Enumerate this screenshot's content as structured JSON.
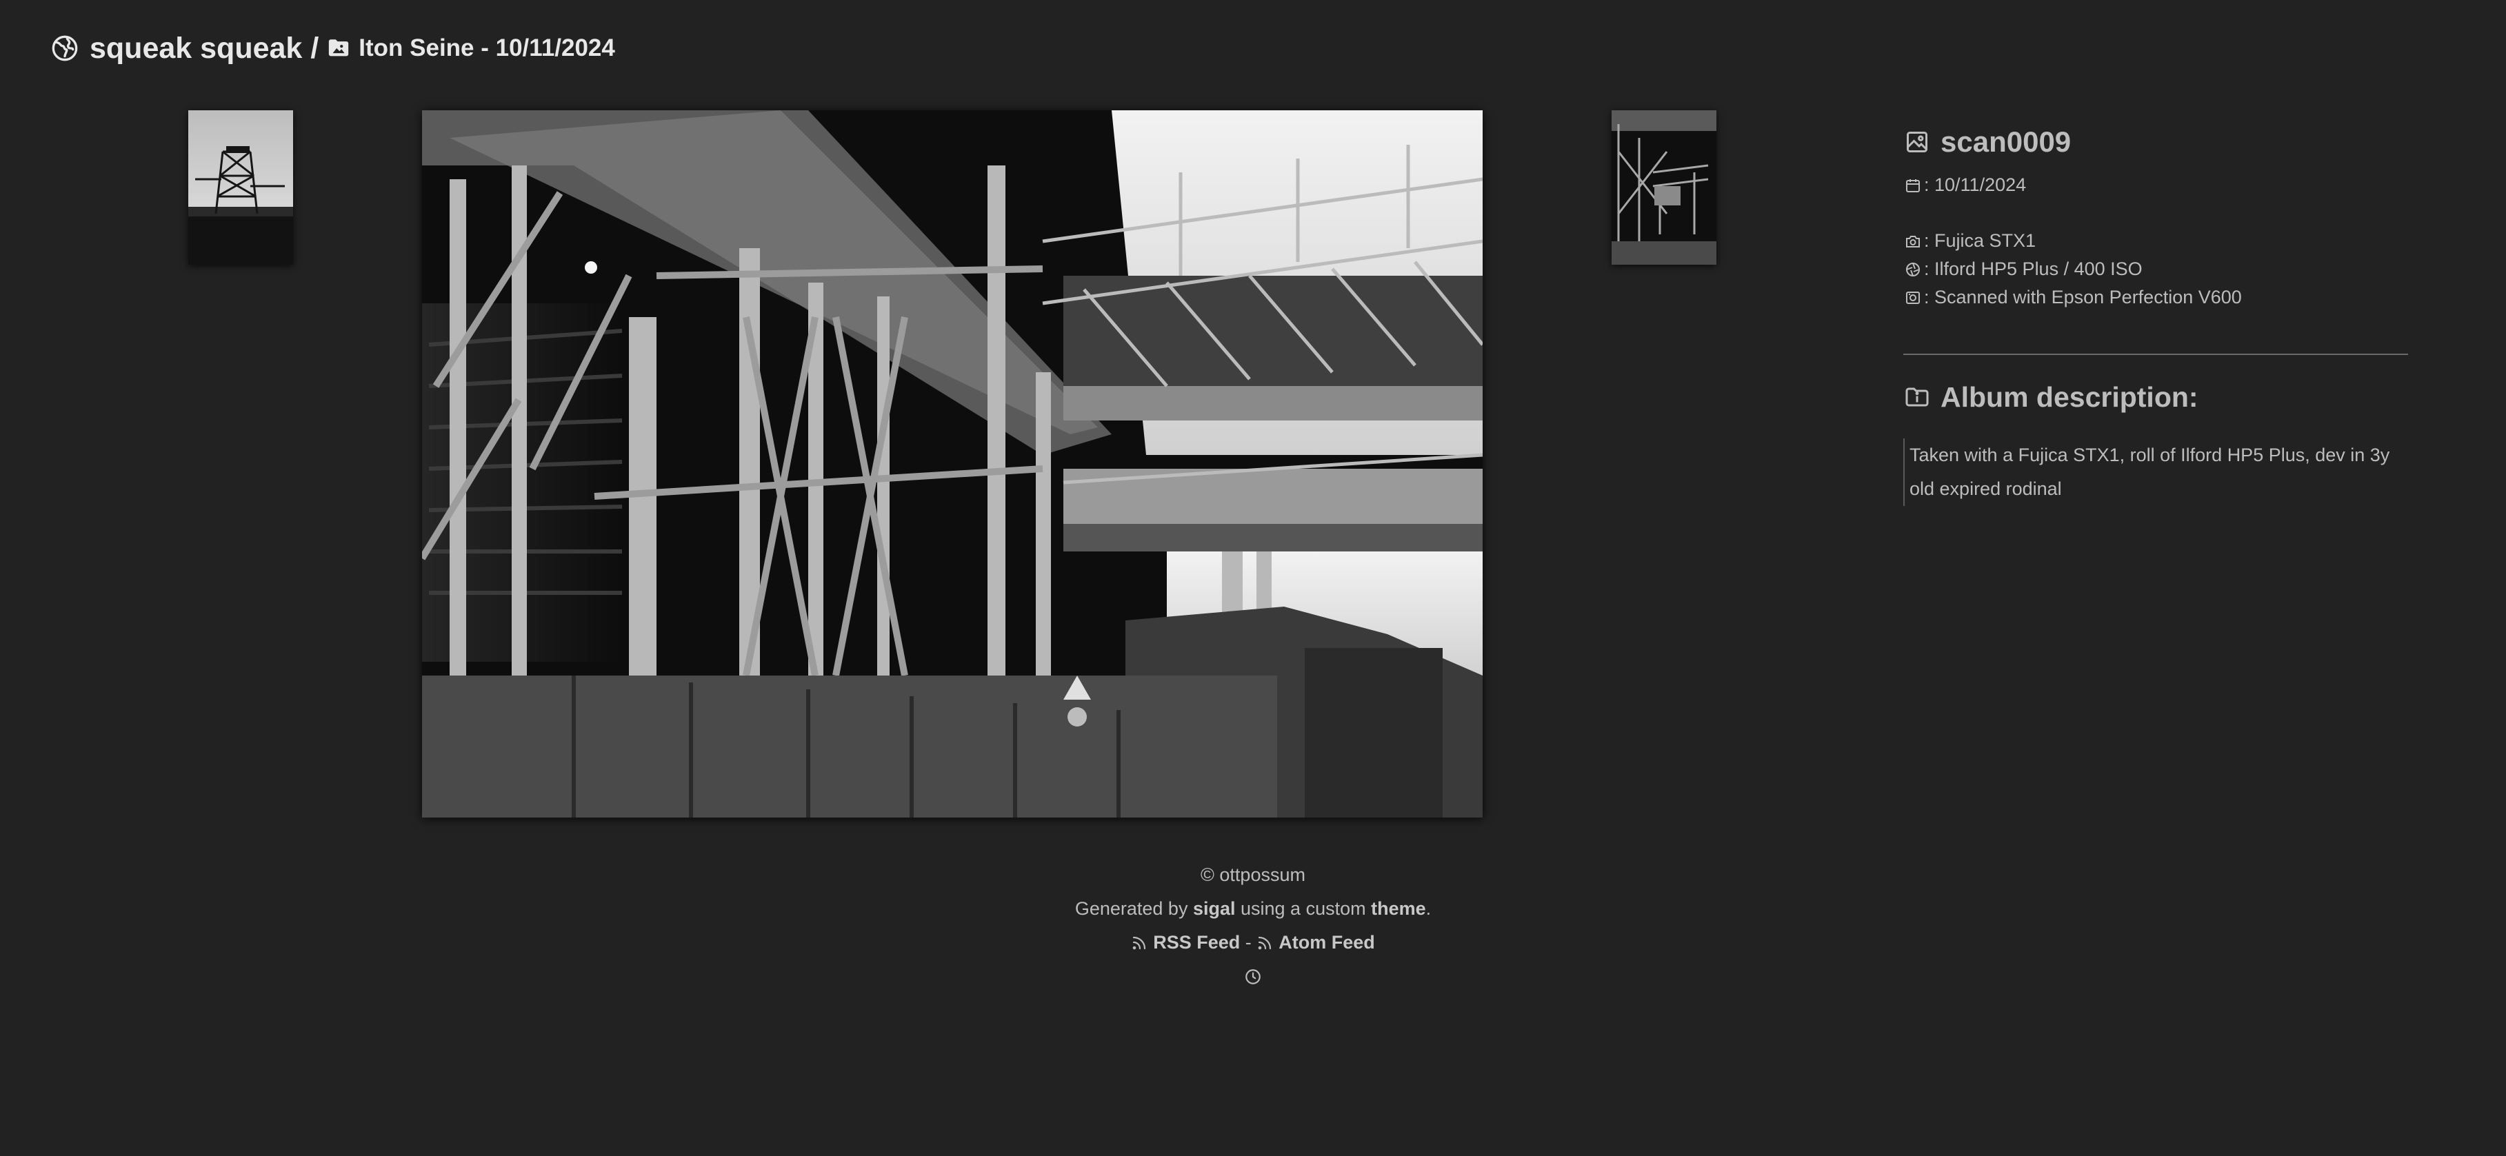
{
  "header": {
    "site_title": "squeak squeak",
    "separator": "/",
    "album_title": "Iton Seine - 10/11/2024",
    "site_icon": "globe-icon",
    "album_icon": "folder-image-icon"
  },
  "nav": {
    "prev_thumb_alt": "previous image",
    "next_thumb_alt": "next image"
  },
  "main_image": {
    "alt": "scan0009"
  },
  "info": {
    "title": "scan0009",
    "title_icon": "image-icon",
    "date": ": 10/11/2024",
    "camera": ": Fujica STX1",
    "film": ": Ilford HP5 Plus / 400 ISO",
    "scanner": ": Scanned with Epson Perfection V600"
  },
  "album_description": {
    "heading": "Album description:",
    "text": "Taken with a Fujica STX1, roll of Ilford HP5 Plus, dev in 3y old expired rodinal"
  },
  "footer": {
    "copyright": "© ottpossum",
    "generated_prefix": "Generated by ",
    "generator": "sigal",
    "using": " using a custom ",
    "theme": "theme",
    "period": ".",
    "rss_label": "RSS Feed",
    "dash": " - ",
    "atom_label": "Atom Feed"
  },
  "colors": {
    "background": "#222222",
    "text": "#bdbdbd",
    "header_text": "#e8e8e8",
    "divider": "#6a6a6a"
  }
}
